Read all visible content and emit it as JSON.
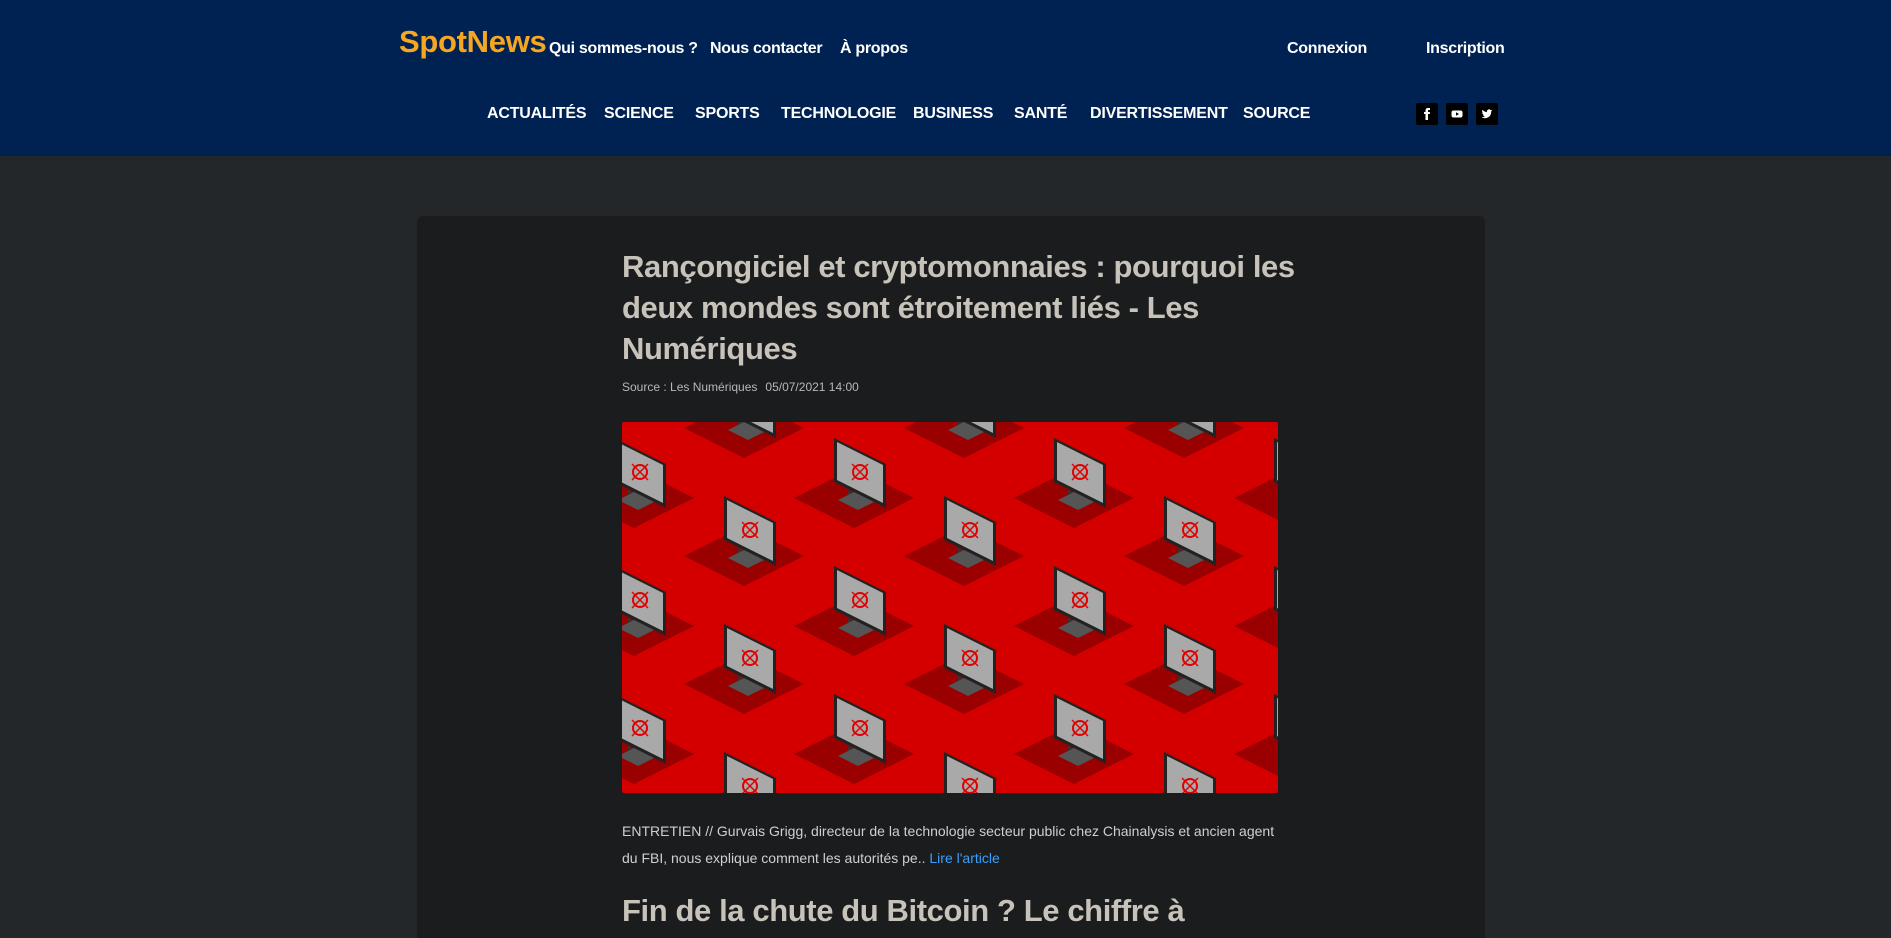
{
  "brand": "SpotNews",
  "top_nav": {
    "about_us": "Qui sommes-nous ?",
    "contact": "Nous contacter",
    "about": "À propos",
    "login": "Connexion",
    "signup": "Inscription"
  },
  "categories": [
    "ACTUALITÉS",
    "SCIENCE",
    "SPORTS",
    "TECHNOLOGIE",
    "BUSINESS",
    "SANTÉ",
    "DIVERTISSEMENT",
    "SOURCE"
  ],
  "social": [
    "facebook-icon",
    "youtube-icon",
    "twitter-icon"
  ],
  "article": {
    "title": "Rançongiciel et cryptomonnaies : pourquoi les deux mondes sont étroitement liés - Les Numériques",
    "source": "Source : Les Numériques",
    "date": "05/07/2021 14:00",
    "excerpt": "ENTRETIEN // Gurvais Grigg, directeur de la technologie secteur public chez Chainalysis et ancien agent du FBI, nous explique comment les autorités pe..",
    "read_more": "Lire l'article"
  },
  "next_article": {
    "title": "Fin de la chute du Bitcoin ? Le chiffre à"
  },
  "colors": {
    "header_bg": "#002252",
    "brand": "#f5a623",
    "page_bg": "#242729",
    "card_bg": "#1b1c1d",
    "link": "#3aa0ff",
    "hero_red": "#d40000"
  }
}
